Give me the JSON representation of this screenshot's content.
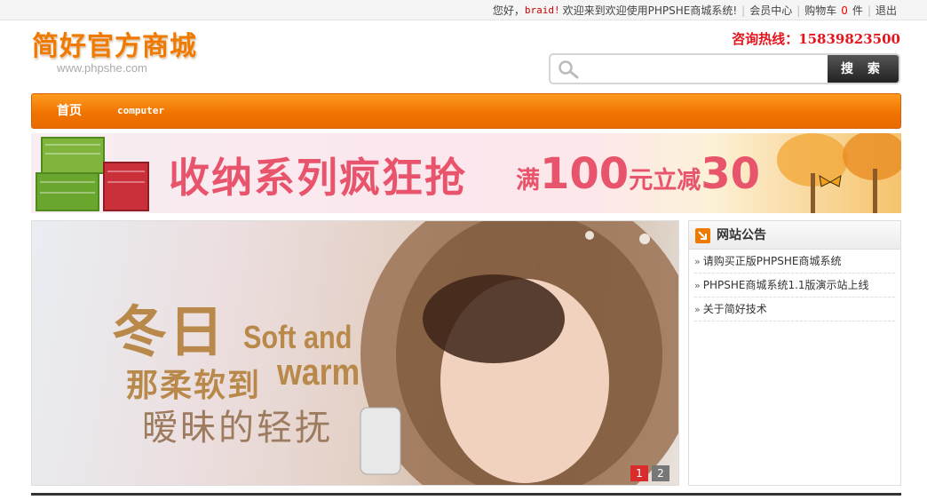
{
  "topbar": {
    "greeting": "您好，",
    "username": "braid!",
    "welcome": "欢迎来到欢迎使用PHPSHE商城系统!",
    "member_center": "会员中心",
    "cart_label": "购物车",
    "cart_count": "0",
    "cart_unit": "件",
    "logout": "退出"
  },
  "header": {
    "logo_text": "简好官方商城",
    "logo_url": "www.phpshe.com",
    "hotline_label": "咨询热线：",
    "hotline_number": "15839823500"
  },
  "search": {
    "placeholder": "",
    "value": "",
    "button_label": "搜 索"
  },
  "nav": {
    "items": [
      {
        "label": "首页"
      },
      {
        "label": "computer"
      }
    ]
  },
  "banner": {
    "title": "收纳系列疯狂抢",
    "promo_prefix": "满",
    "promo_amount": "100",
    "promo_middle": "元立减",
    "promo_discount": "30"
  },
  "slideshow": {
    "line1": "冬日",
    "line2": "Soft and",
    "line3": "那柔软到",
    "line4": "warm",
    "line5": "暧昧的轻抚",
    "pages": [
      "1",
      "2"
    ],
    "active_page": 1
  },
  "notice": {
    "title": "网站公告",
    "items": [
      {
        "text": "请购买正版PHPSHE商城系统"
      },
      {
        "text": "PHPSHE商城系统1.1版演示站上线"
      },
      {
        "text": "关于简好技术"
      }
    ]
  },
  "colors": {
    "accent_orange": "#f07a00",
    "hotline_red": "#e5141d",
    "banner_pink": "#e8546c",
    "slide_gold": "#b8894a"
  }
}
